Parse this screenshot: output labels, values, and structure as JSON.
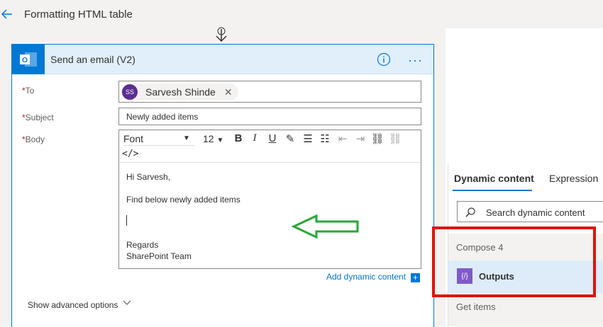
{
  "header": {
    "title": "Formatting HTML table"
  },
  "card": {
    "title": "Send an email (V2)",
    "to_label": "To",
    "subject_label": "Subject",
    "body_label": "Body",
    "recipient": {
      "initials": "SS",
      "name": "Sarvesh Shinde"
    },
    "subject_value": "Newly added items",
    "toolbar": {
      "font": "Font",
      "size": "12"
    },
    "body_lines": [
      "Hi Sarvesh,",
      "Find below newly added items",
      "Regards",
      "SharePoint Team"
    ],
    "add_dynamic_label": "Add dynamic content",
    "advanced_label": "Show advanced options"
  },
  "dynamic_panel": {
    "tabs": [
      "Dynamic content",
      "Expression"
    ],
    "search_placeholder": "Search dynamic content",
    "groups": [
      "Compose 4",
      "Get items"
    ],
    "item_label": "Outputs"
  },
  "colors": {
    "accent": "#0078d4",
    "highlight": "#e3120b",
    "arrow": "#27a737"
  }
}
